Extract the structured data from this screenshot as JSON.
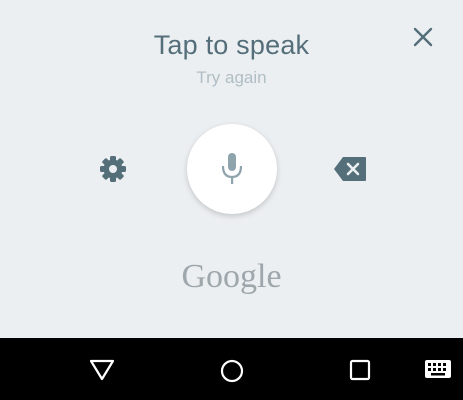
{
  "voice": {
    "title": "Tap to speak",
    "subtitle": "Try again",
    "logo_text": "Google"
  },
  "icons": {
    "close": "close-icon",
    "settings": "gear-icon",
    "mic": "microphone-icon",
    "backspace": "backspace-icon"
  },
  "navbar": {
    "buttons": [
      "back-icon",
      "home-icon",
      "recents-icon",
      "keyboard-icon"
    ]
  },
  "colors": {
    "background": "#eceff1",
    "title": "#546e7a",
    "subtitle": "#b0bec5",
    "icon": "#546e7a",
    "mic_bg": "#ffffff",
    "navbar": "#000000"
  }
}
